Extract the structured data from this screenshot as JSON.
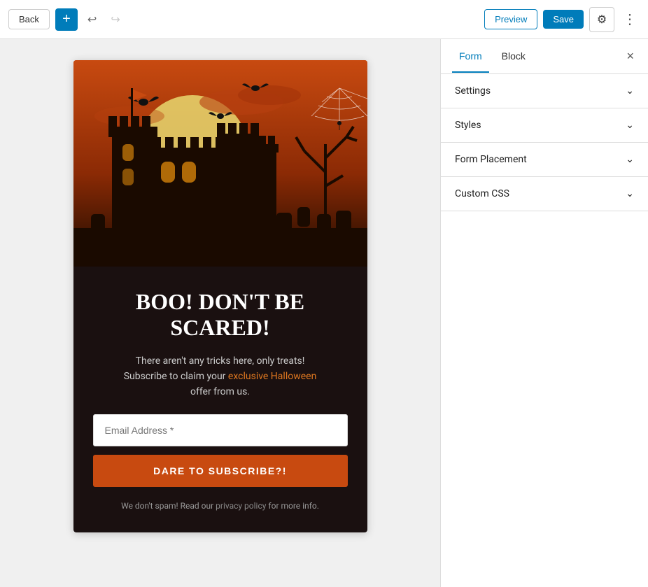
{
  "toolbar": {
    "back_label": "Back",
    "preview_label": "Preview",
    "save_label": "Save",
    "plus_icon": "+",
    "undo_icon": "↩",
    "redo_icon": "↪",
    "gear_icon": "⚙",
    "dots_icon": "⋮"
  },
  "panel": {
    "tab_form": "Form",
    "tab_block": "Block",
    "close_icon": "×",
    "sections": [
      {
        "id": "settings",
        "label": "Settings"
      },
      {
        "id": "styles",
        "label": "Styles"
      },
      {
        "id": "form-placement",
        "label": "Form Placement"
      },
      {
        "id": "custom-css",
        "label": "Custom CSS"
      }
    ]
  },
  "form": {
    "title": "BOO! DON'T BE SCARED!",
    "body_text_1": "There aren't any tricks here, only treats!",
    "body_text_2": "Subscribe to claim your",
    "highlight_text": "exclusive Halloween",
    "body_text_3": "offer from us.",
    "email_placeholder": "Email Address *",
    "subscribe_label": "DARE TO SUBSCRIBE?!",
    "footer_text_1": "We don't spam! Read our",
    "footer_link": "privacy policy",
    "footer_text_2": "for more info."
  }
}
